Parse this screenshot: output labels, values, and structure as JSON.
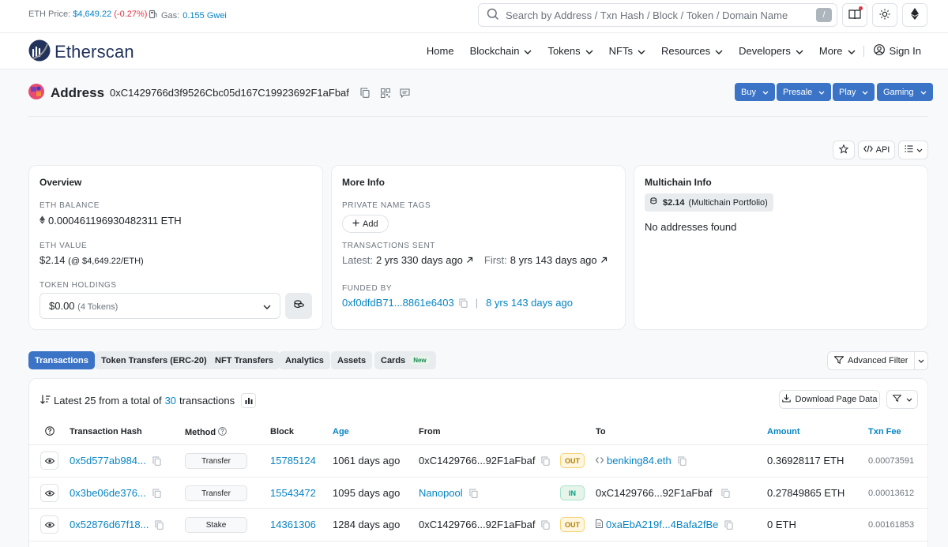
{
  "topbar": {
    "eth_price_label": "ETH Price:",
    "eth_price_value": "$4,649.22",
    "eth_price_change": "(-0.27%)",
    "gas_label": "Gas:",
    "gas_value": "0.155 Gwei",
    "search_placeholder": "Search by Address / Txn Hash / Block / Token / Domain Name",
    "search_shortcut": "/"
  },
  "nav": {
    "logo": "Etherscan",
    "items": [
      "Home",
      "Blockchain",
      "Tokens",
      "NFTs",
      "Resources",
      "Developers",
      "More"
    ],
    "sign_in": "Sign In"
  },
  "address": {
    "heading": "Address",
    "hash": "0xC1429766d3f9526Cbc05d167C19923692F1aFbaf",
    "actions": [
      "Buy",
      "Presale",
      "Play",
      "Gaming"
    ]
  },
  "tools": {
    "api": "API"
  },
  "overview": {
    "title": "Overview",
    "eth_balance_label": "ETH BALANCE",
    "eth_balance": "0.000461196930482311 ETH",
    "eth_value_label": "ETH VALUE",
    "eth_value": "$2.14",
    "eth_value_rate": "(@ $4,649.22/ETH)",
    "token_holdings_label": "TOKEN HOLDINGS",
    "token_value": "$0.00",
    "token_count": "(4 Tokens)"
  },
  "more_info": {
    "title": "More Info",
    "private_tags_label": "PRIVATE NAME TAGS",
    "add_label": "Add",
    "tx_sent_label": "TRANSACTIONS SENT",
    "latest_label": "Latest:",
    "latest_value": "2 yrs 330 days ago",
    "first_label": "First:",
    "first_value": "8 yrs 143 days ago",
    "funded_by_label": "FUNDED BY",
    "funded_by_addr": "0xf0dfdB71...8861e6403",
    "funded_by_age": "8 yrs 143 days ago"
  },
  "multichain": {
    "title": "Multichain Info",
    "portfolio_value": "$2.14",
    "portfolio_label": "(Multichain Portfolio)",
    "empty_text": "No addresses found"
  },
  "tabs": [
    {
      "label": "Transactions"
    },
    {
      "label": "Token Transfers (ERC-20)"
    },
    {
      "label": "NFT Transfers"
    },
    {
      "label": "Analytics"
    },
    {
      "label": "Assets"
    },
    {
      "label": "Cards",
      "badge": "New"
    }
  ],
  "advanced_filter": "Advanced Filter",
  "txlist": {
    "summary_prefix": "Latest 25 from a total of",
    "summary_total": "30",
    "summary_suffix": "transactions",
    "download": "Download Page Data",
    "columns": [
      "Transaction Hash",
      "Method",
      "Block",
      "Age",
      "From",
      "To",
      "Amount",
      "Txn Fee"
    ],
    "rows": [
      {
        "hash": "0x5d577ab984...",
        "method": "Transfer",
        "block": "15785124",
        "age": "1061 days ago",
        "from": "0xC1429766...92F1aFbaf",
        "direction": "OUT",
        "to": "benking84.eth",
        "amount": "0.36928117 ETH",
        "fee": "0.00073591"
      },
      {
        "hash": "0x3be06de376...",
        "method": "Transfer",
        "block": "15543472",
        "age": "1095 days ago",
        "from": "Nanopool",
        "direction": "IN",
        "to": "0xC1429766...92F1aFbaf",
        "amount": "0.27849865 ETH",
        "fee": "0.00013612"
      },
      {
        "hash": "0x52876d67f18...",
        "method": "Stake",
        "block": "14361306",
        "age": "1284 days ago",
        "from": "0xC1429766...92F1aFbaf",
        "direction": "OUT",
        "to": "0xaEbA219f...4Bafa2fBe",
        "amount": "0 ETH",
        "fee": "0.00161853"
      }
    ]
  }
}
